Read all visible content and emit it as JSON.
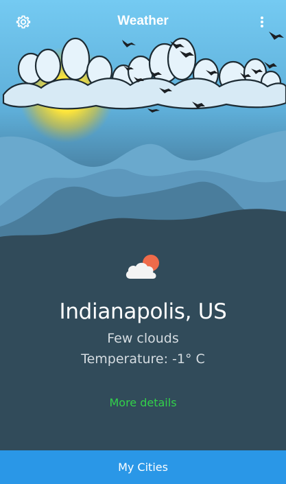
{
  "app_bar": {
    "title": "Weather",
    "settings_icon": "gear-icon",
    "menu_icon": "more-vertical-icon"
  },
  "current": {
    "condition_icon": "cloud-with-sun-icon",
    "city": "Indianapolis, US",
    "description": "Few clouds",
    "temperature": "Temperature: -1°  C",
    "more_link": "More details"
  },
  "footer": {
    "button_label": "My Cities"
  },
  "colors": {
    "sky_top": "#6fc6ef",
    "sun": "#ffe94a",
    "bottom_bar": "#2a97e7",
    "link": "#32d24a",
    "panel": "#314b5a"
  }
}
